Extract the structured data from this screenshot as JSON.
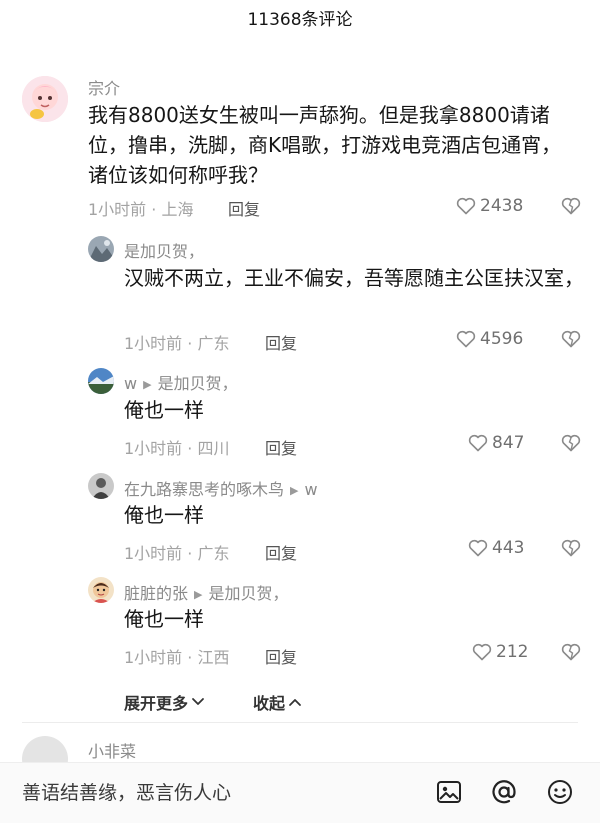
{
  "header": {
    "title": "11368条评论"
  },
  "main_comment": {
    "username": "宗介",
    "text": "我有8800送女生被叫一声舔狗。但是我拿8800请诸位，撸串，洗脚，商K唱歌，打游戏电竞酒店包通宵，诸位该如何称呼我？",
    "meta": "1小时前 · 上海",
    "reply_label": "回复",
    "likes": "2438"
  },
  "replies": [
    {
      "username": "是加贝贺，",
      "reply_to": "",
      "text": "汉贼不两立，王业不偏安，吾等愿随主公匡扶汉室，",
      "meta": "1小时前 · 广东",
      "reply_label": "回复",
      "likes": "4596"
    },
    {
      "username": "w",
      "reply_to": "是加贝贺，",
      "text": "俺也一样",
      "meta": "1小时前 · 四川",
      "reply_label": "回复",
      "likes": "847"
    },
    {
      "username": "在九路寨思考的啄木鸟",
      "reply_to": "w",
      "text": "俺也一样",
      "meta": "1小时前 · 广东",
      "reply_label": "回复",
      "likes": "443"
    },
    {
      "username": "脏脏的张",
      "reply_to": "是加贝贺，",
      "text": "俺也一样",
      "meta": "1小时前 · 江西",
      "reply_label": "回复",
      "likes": "212"
    }
  ],
  "expand": {
    "more_label": "展开更多",
    "collapse_label": "收起"
  },
  "next_comment": {
    "username": "小非菜"
  },
  "input": {
    "placeholder": "善语结善缘，恶言伤人心"
  },
  "colors": {
    "accent": "#161616",
    "meta": "#a3a3a3",
    "background": "#ffffff"
  },
  "icons": {
    "like": "heart-icon",
    "dislike": "broken-heart-icon",
    "image": "image-icon",
    "mention": "at-icon",
    "emoji": "smiley-icon"
  }
}
